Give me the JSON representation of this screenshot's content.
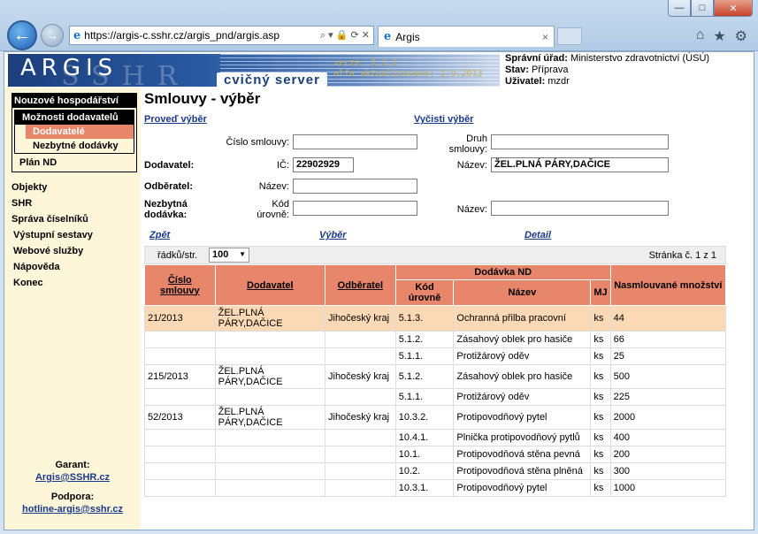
{
  "browser": {
    "url": "https://argis-c.sshr.cz/argis_pnd/argis.asр",
    "tab_title": "Argis",
    "tab_close": "×",
    "win_min": "—",
    "win_max": "□",
    "win_close": "✕",
    "back_glyph": "←",
    "fwd_glyph": "→",
    "ie_glyph": "e",
    "addr_icons": "⌕ ▾ 🔒 ⟳ ✕",
    "right_icons": [
      "⌂",
      "★",
      "⚙"
    ]
  },
  "header": {
    "logo_text": "ARGIS",
    "logo_watermark": "SSHR",
    "server_label": "cvičný server",
    "version_line1": "verze: 2.3.2",
    "version_line2": "alfa aktualizováno: 1.9.2013",
    "office_label": "Správní úřad:",
    "office_value": "Ministerstvo zdravotnictví (ÚSÚ)",
    "state_label": "Stav:",
    "state_value": "Příprava",
    "user_label": "Uživatel:",
    "user_value": "mzdr"
  },
  "sidebar": {
    "main_head": "Nouzové hospodářství",
    "sub_head": "Možnosti dodavatelů",
    "leaf_suppliers": "Dodavatelé",
    "leaf_deliveries": "Nezbytné dodávky",
    "plan": "Plán ND",
    "links": [
      "Objekty",
      "SHR",
      "Správa číselníků",
      "Výstupní sestavy",
      "Webové služby",
      "Nápověda",
      "Konec"
    ],
    "guarantee_label": "Garant:",
    "guarantee_email": "Argis@SSHR.cz",
    "support_label": "Podpora:",
    "support_email": "hotline-argis@sshr.cz"
  },
  "main": {
    "title": "Smlouvy - výběr",
    "do_select": "Proveď výběr",
    "clear_select": "Vyčisti výběr",
    "contract_no_label": "Číslo smlouvy:",
    "contract_no_value": "",
    "kind_label": "Druh smlouvy:",
    "kind_value": "",
    "supplier_label": "Dodavatel:",
    "ic_label": "IČ:",
    "ic_value": "22902929",
    "name_label": "Název:",
    "supplier_name_value": "ŽEL.PLNÁ PÁRY,DAČICE",
    "customer_label": "Odběratel:",
    "customer_name_value": "",
    "delivery_label": "Nezbytná dodávka:",
    "level_code_label": "Kód úrovně:",
    "level_code_value": "",
    "delivery_name_value": "",
    "back_link": "Zpět",
    "select_link": "Výběr",
    "detail_link": "Detail",
    "rows_label": "řádků/str.",
    "rows_value": "100",
    "page_info": "Stránka č. 1 z 1"
  },
  "table": {
    "headers": {
      "contract_no": "Číslo smlouvy",
      "supplier": "Dodavatel",
      "customer": "Odběratel",
      "delivery_group": "Dodávka ND",
      "level_code": "Kód úrovně",
      "name": "Název",
      "unit": "MJ",
      "quantity": "Nasmlouvané množství"
    },
    "rows": [
      {
        "contract": "21/2013",
        "supplier": "ŽEL.PLNÁ PÁRY,DAČICE",
        "customer": "Jihočeský kraj",
        "code": "5.1.3.",
        "name": "Ochranná přilba pracovní",
        "unit": "ks",
        "qty": "44"
      },
      {
        "contract": "",
        "supplier": "",
        "customer": "",
        "code": "5.1.2.",
        "name": "Zásahový oblek pro hasiče",
        "unit": "ks",
        "qty": "66"
      },
      {
        "contract": "",
        "supplier": "",
        "customer": "",
        "code": "5.1.1.",
        "name": "Protižárový oděv",
        "unit": "ks",
        "qty": "25"
      },
      {
        "contract": "215/2013",
        "supplier": "ŽEL.PLNÁ PÁRY,DAČICE",
        "customer": "Jihočeský kraj",
        "code": "5.1.2.",
        "name": "Zásahový oblek pro hasiče",
        "unit": "ks",
        "qty": "500"
      },
      {
        "contract": "",
        "supplier": "",
        "customer": "",
        "code": "5.1.1.",
        "name": "Protižárový oděv",
        "unit": "ks",
        "qty": "225"
      },
      {
        "contract": "52/2013",
        "supplier": "ŽEL.PLNÁ PÁRY,DAČICE",
        "customer": "Jihočeský kraj",
        "code": "10.3.2.",
        "name": "Protipovodňový pytel",
        "unit": "ks",
        "qty": "2000"
      },
      {
        "contract": "",
        "supplier": "",
        "customer": "",
        "code": "10.4.1.",
        "name": "Plnička protipovodňový pytlů",
        "unit": "ks",
        "qty": "400"
      },
      {
        "contract": "",
        "supplier": "",
        "customer": "",
        "code": "10.1.",
        "name": "Protipovodňová stěna pevná",
        "unit": "ks",
        "qty": "200"
      },
      {
        "contract": "",
        "supplier": "",
        "customer": "",
        "code": "10.2.",
        "name": "Protipovodňová stěna plněná",
        "unit": "ks",
        "qty": "300"
      },
      {
        "contract": "",
        "supplier": "",
        "customer": "",
        "code": "10.3.1.",
        "name": "Protipovodňový pytel",
        "unit": "ks",
        "qty": "1000"
      }
    ]
  }
}
